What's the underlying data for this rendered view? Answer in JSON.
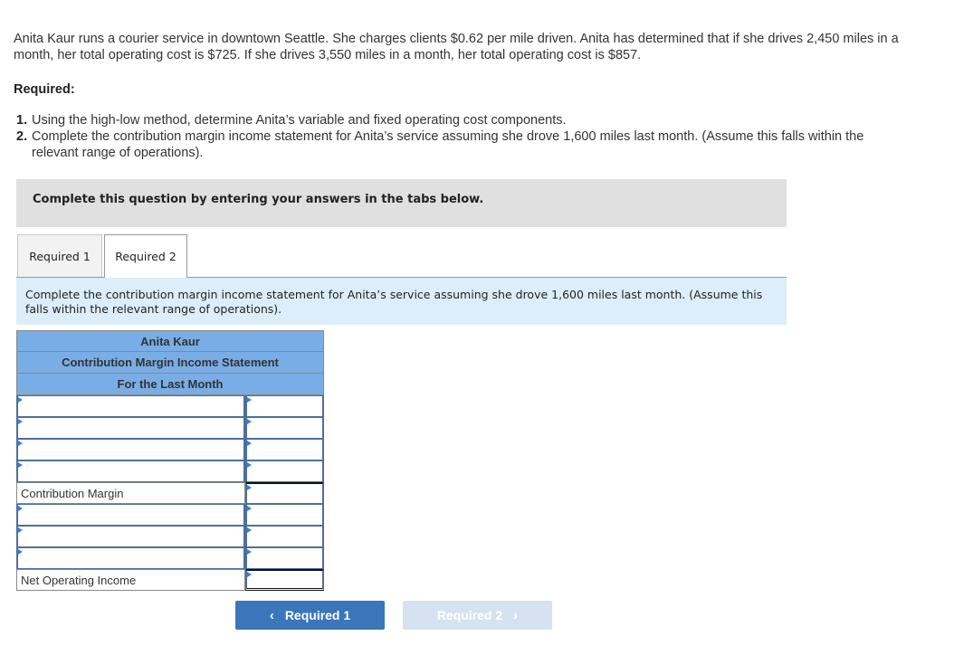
{
  "problem": {
    "intro": "Anita Kaur runs a courier service in downtown Seattle. She charges clients $0.62 per mile driven. Anita has determined that if she drives 2,450 miles in a month, her total operating cost is $725. If she drives 3,550 miles in a month, her total operating cost is $857.",
    "required_heading": "Required:",
    "requirements": [
      {
        "num": "1.",
        "text": "Using the high-low method, determine Anita’s variable and fixed operating cost components."
      },
      {
        "num": "2.",
        "text": "Complete the contribution margin income statement for Anita’s service assuming she drove 1,600 miles last month. (Assume this falls within the relevant range of operations)."
      }
    ]
  },
  "instruction": "Complete this question by entering your answers in the tabs below.",
  "tabs": [
    {
      "label": "Required 1",
      "active": false
    },
    {
      "label": "Required 2",
      "active": true
    }
  ],
  "tab_description": "Complete the contribution margin income statement for Anita’s service assuming she drove 1,600 miles last month. (Assume this falls within the relevant range of operations).",
  "statement": {
    "company": "Anita Kaur",
    "title": "Contribution Margin Income Statement",
    "period": "For the Last Month",
    "rows": [
      {
        "type": "input",
        "label": "",
        "amount": ""
      },
      {
        "type": "input",
        "label": "",
        "amount": ""
      },
      {
        "type": "input",
        "label": "",
        "amount": ""
      },
      {
        "type": "input",
        "label": "",
        "amount": ""
      },
      {
        "type": "static",
        "label": "Contribution Margin",
        "amount": ""
      },
      {
        "type": "input",
        "label": "",
        "amount": ""
      },
      {
        "type": "input",
        "label": "",
        "amount": ""
      },
      {
        "type": "input",
        "label": "",
        "amount": ""
      },
      {
        "type": "static",
        "label": "Net Operating Income",
        "amount": ""
      }
    ]
  },
  "navigation": {
    "prev_label": "Required 1",
    "next_label": "Required 2",
    "prev_enabled": true,
    "next_enabled": false
  },
  "colors": {
    "header_blue": "#79ade6",
    "nav_button": "#3a76b9",
    "nav_button_disabled": "#d6e2f0",
    "tab_description_bg": "#dbeef9",
    "instruction_bg": "#e0e0e0"
  }
}
